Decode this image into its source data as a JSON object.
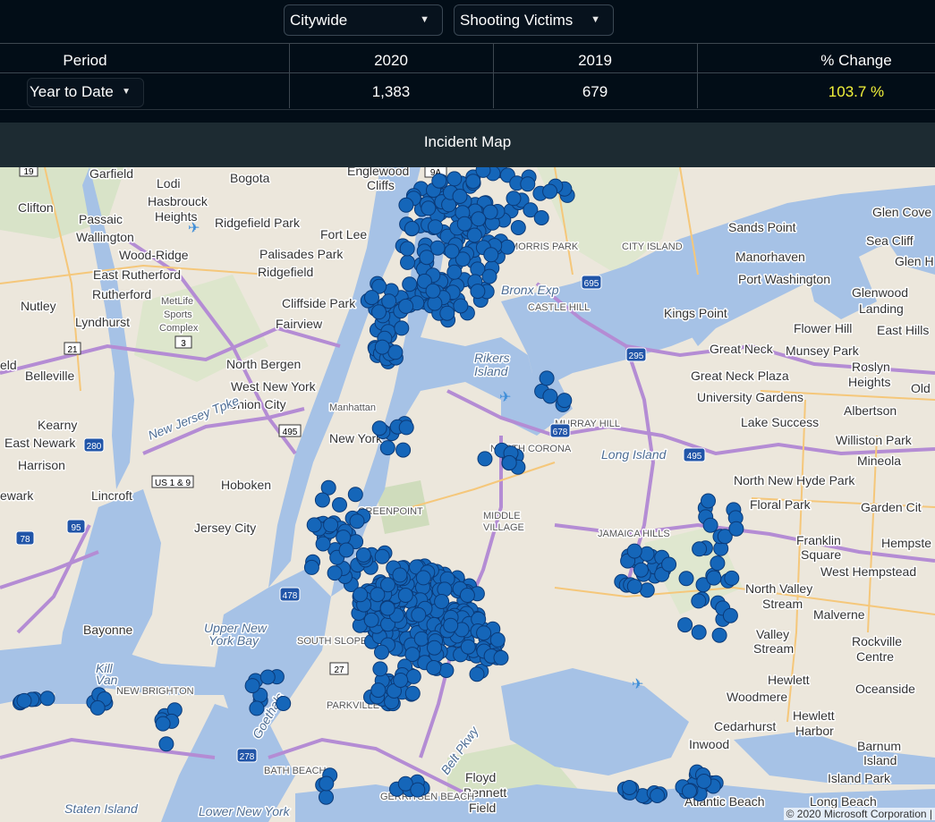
{
  "filters": {
    "area": "Citywide",
    "metric": "Shooting Victims"
  },
  "stats": {
    "headers": {
      "period": "Period",
      "year_current": "2020",
      "year_previous": "2019",
      "change": "% Change"
    },
    "period_value": "Year to Date",
    "current_value": "1,383",
    "previous_value": "679",
    "change_value": "103.7 %",
    "change_color": "#f3f33a"
  },
  "map": {
    "title": "Incident Map",
    "copyright": "© 2020 Microsoft Corporation |",
    "marker_color": "#1566b9",
    "labels": {
      "garfield": "Garfield",
      "lodi": "Lodi",
      "bogota": "Bogota",
      "englewood_cliffs_1": "Englewood",
      "englewood_cliffs_2": "Cliffs",
      "clifton": "Clifton",
      "hasbrouck_1": "Hasbrouck",
      "hasbrouck_2": "Heights",
      "passaic": "Passaic",
      "wallington": "Wallington",
      "ridgefield_park": "Ridgefield Park",
      "fort_lee": "Fort Lee",
      "palisades_park": "Palisades Park",
      "ridgefield": "Ridgefield",
      "wood_ridge": "Wood-Ridge",
      "east_rutherford": "East Rutherford",
      "rutherford": "Rutherford",
      "nutley": "Nutley",
      "lyndhurst": "Lyndhurst",
      "cliffside_park": "Cliffside Park",
      "fairview": "Fairview",
      "north_bergen": "North Bergen",
      "west_new_york": "West New York",
      "union_city": "Union City",
      "belleville": "Belleville",
      "kearny": "Kearny",
      "east_newark": "East Newark",
      "harrison": "Harrison",
      "newark": "ewark",
      "lincroft": "Lincroft",
      "hoboken": "Hoboken",
      "jersey_city": "Jersey City",
      "new_york": "New York",
      "bayonne": "Bayonne",
      "upper_ny_bay_1": "Upper New",
      "upper_ny_bay_2": "York Bay",
      "kill_van_1": "Kill",
      "kill_van_2": "Van",
      "staten_island": "Staten Island",
      "lower_ny_bay": "Lower New York",
      "city_island": "CITY ISLAND",
      "sands_point": "Sands Point",
      "manorhaven": "Manorhaven",
      "port_washington": "Port Washington",
      "glen_cove": "Glen Cove",
      "sea_cliff": "Sea Cliff",
      "glen_h": "Glen H",
      "glenwood_1": "Glenwood",
      "glenwood_2": "Landing",
      "kings_point": "Kings Point",
      "flower_hill": "Flower Hill",
      "munsey_park": "Munsey Park",
      "east_hills": "East Hills",
      "great_neck": "Great Neck",
      "great_neck_plaza": "Great Neck Plaza",
      "roslyn_1": "Roslyn",
      "roslyn_2": "Heights",
      "university_gardens": "University Gardens",
      "lake_success": "Lake Success",
      "albertson": "Albertson",
      "old": "Old",
      "williston_park": "Williston Park",
      "mineola": "Mineola",
      "rikers_1": "Rikers",
      "rikers_2": "Island",
      "long_island": "Long Island",
      "north_new_hyde_park": "North New Hyde Park",
      "floral_park": "Floral Park",
      "garden_city": "Garden Cit",
      "franklin_1": "Franklin",
      "franklin_2": "Square",
      "hempstead": "Hempste",
      "west_hempstead": "West Hempstead",
      "north_valley_1": "North Valley",
      "north_valley_2": "Stream",
      "malverne": "Malverne",
      "valley_1": "Valley",
      "valley_2": "Stream",
      "rockville_1": "Rockville",
      "rockville_2": "Centre",
      "hewlett": "Hewlett",
      "woodmere": "Woodmere",
      "oceanside": "Oceanside",
      "hewlett_harbor_1": "Hewlett",
      "hewlett_harbor_2": "Harbor",
      "cedarhurst": "Cedarhurst",
      "inwood": "Inwood",
      "barnum_1": "Barnum",
      "barnum_2": "Island",
      "island_park": "Island Park",
      "atlantic_beach": "Atlantic Beach",
      "long_beach": "Long Beach",
      "floyd_1": "Floyd",
      "floyd_2": "Bennett",
      "floyd_3": "Field",
      "manhattan": "Manhattan",
      "north_corona": "NORTH CORONA",
      "murray_hill": "MURRAY HILL",
      "middle_1": "MIDDLE",
      "middle_2": "VILLAGE",
      "jamaica_hills": "JAMAICA HILLS",
      "greenpoint": "GREENPOINT",
      "south_slope": "SOUTH SLOPE",
      "parkville": "PARKVILLE",
      "bath_beach": "BATH BEACH",
      "gerritsen_beach": "GERRITSEN BEACH",
      "new_brighton": "NEW BRIGHTON",
      "morris_park": "MORRIS PARK",
      "castle_hill": "CASTLE HILL",
      "metlife_1": "MetLife",
      "metlife_2": "Sports",
      "metlife_3": "Complex",
      "eld": "eld",
      "nj_tpke": "New Jersey Tpke",
      "belt_pkwy": "Belt Pkwy",
      "goethals": "Goethals",
      "bronx_exp": "Bronx Exp"
    },
    "shields": {
      "s19": "19",
      "s9a": "9A",
      "s21": "21",
      "s3": "3",
      "s495": "495",
      "s280": "280",
      "s95": "95",
      "s78": "78",
      "s478": "478",
      "s27": "27",
      "s278": "278",
      "s695": "695",
      "s295": "295",
      "s678": "678",
      "s495b": "495",
      "us19": "US 1 & 9"
    }
  }
}
